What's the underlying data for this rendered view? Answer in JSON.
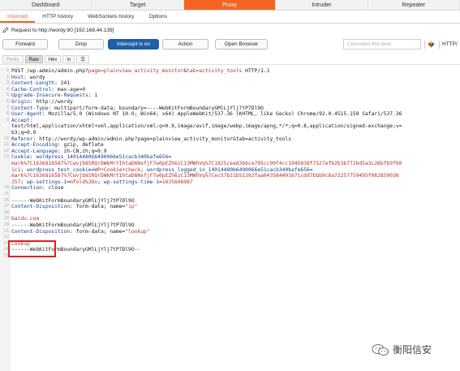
{
  "top_tabs": [
    {
      "label": "Dashboard",
      "active": false
    },
    {
      "label": "Target",
      "active": false
    },
    {
      "label": "Proxy",
      "active": true
    },
    {
      "label": "Intruder",
      "active": false
    },
    {
      "label": "Repeater",
      "active": false
    }
  ],
  "sub_tabs": [
    {
      "label": "Intercept",
      "active": true
    },
    {
      "label": "HTTP history",
      "active": false
    },
    {
      "label": "WebSockets history",
      "active": false
    },
    {
      "label": "Options",
      "active": false
    }
  ],
  "request_info": "Request to http://wordy:80  [192.168.44.139]",
  "toolbar": {
    "forward": "Forward",
    "drop": "Drop",
    "intercept": "Intercept is on",
    "action": "Action",
    "open_browser": "Open Browser",
    "comment_placeholder": "Comment this item",
    "http_label": "HTTP/"
  },
  "view_tabs": [
    "Pretty",
    "Raw",
    "Hex",
    "\\n",
    "☰"
  ],
  "editor_lines": [
    {
      "n": "1",
      "segs": [
        [
          "POST /wp-admin/admin.php?",
          ""
        ],
        [
          "page=plainview_activity_monitor",
          "r"
        ],
        [
          "&",
          ""
        ],
        [
          "tab=activity_tools",
          "r"
        ],
        [
          " HTTP/1.1",
          ""
        ]
      ]
    },
    {
      "n": "2",
      "segs": [
        [
          "Host",
          "k"
        ],
        [
          ": wordy",
          ""
        ]
      ]
    },
    {
      "n": "3",
      "segs": [
        [
          "Content-Length",
          "k"
        ],
        [
          ": 241",
          ""
        ]
      ]
    },
    {
      "n": "4",
      "segs": [
        [
          "Cache-Control",
          "k"
        ],
        [
          ": max-age=0",
          ""
        ]
      ]
    },
    {
      "n": "5",
      "segs": [
        [
          "Upgrade-Insecure-Requests",
          "k"
        ],
        [
          ": 1",
          ""
        ]
      ]
    },
    {
      "n": "6",
      "segs": [
        [
          "Origin",
          "k"
        ],
        [
          ": http://wordy",
          ""
        ]
      ]
    },
    {
      "n": "7",
      "segs": [
        [
          "Content-Type",
          "k"
        ],
        [
          ": multipart/form-data; boundary=----WebKitFormBoundaryGMlLjYlj7tP7Dl9O",
          ""
        ]
      ]
    },
    {
      "n": "8",
      "segs": [
        [
          "User-Agent",
          "k"
        ],
        [
          ": Mozilla/5.0 (Windows NT 10.0; Win64; x64) AppleWebKit/537.36 (KHTML, like Gecko) Chrome/92.0.4515.159 Safari/537.36",
          ""
        ]
      ]
    },
    {
      "n": "9",
      "segs": [
        [
          "Accept",
          "k"
        ],
        [
          ":",
          ""
        ]
      ]
    },
    {
      "n": "",
      "segs": [
        [
          "text/html,application/xhtml+xml,application/xml;q=0.9,image/avif,image/webp,image/apng,*/*;q=0.8,application/signed-exchange;v=",
          ""
        ]
      ]
    },
    {
      "n": "",
      "segs": [
        [
          "b3;q=0.9",
          ""
        ]
      ]
    },
    {
      "n": "10",
      "segs": [
        [
          "Referer",
          "k"
        ],
        [
          ": http://wordy/wp-admin/admin.php?page=plainview_activity_monitor&tab=activity_tools",
          ""
        ]
      ]
    },
    {
      "n": "11",
      "segs": [
        [
          "Accept-Encoding",
          "k"
        ],
        [
          ": gzip, deflate",
          ""
        ]
      ]
    },
    {
      "n": "12",
      "segs": [
        [
          "Accept-Language",
          "k"
        ],
        [
          ": zh-CN,zh;q=0.9",
          ""
        ]
      ]
    },
    {
      "n": "13",
      "segs": [
        [
          "Cookie",
          "k"
        ],
        [
          ": ",
          ""
        ],
        [
          "wordpress_14014480b6490066e51cacb340bafe656",
          "b"
        ],
        [
          "=",
          ""
        ]
      ]
    },
    {
      "n": "",
      "segs": [
        [
          "mark%7C1636816587%7Cwvjb85RQrDWkMrYIhtaD6NxfjF7w0pEZh6zC13MWhVq%7C1825cead366ce795cc90f4cc1945038f7527efb2b3b772bd5a3c26bfb9f60",
          "r"
        ]
      ]
    },
    {
      "n": "",
      "segs": [
        [
          "1c1",
          "r"
        ],
        [
          "; ",
          ""
        ],
        [
          "wordpress_test_cookie",
          "b"
        ],
        [
          "=",
          ""
        ],
        [
          "WP+Cookie+check",
          "r"
        ],
        [
          "; ",
          ""
        ],
        [
          "wordpress_logged_in_14014480b6490066e51cacb340bafe656",
          "b"
        ],
        [
          "=",
          ""
        ]
      ]
    },
    {
      "n": "",
      "segs": [
        [
          "mark%7C1636816587%7Cwvjb85RQrDWkMrYIhtaD6NxfjF7w0pEZh6zC13MWhVq%7Cec57b31b51392faa043584491671cdd7bbb9c8a72257759495f062859036",
          "r"
        ]
      ]
    },
    {
      "n": "",
      "segs": [
        [
          "357",
          "r"
        ],
        [
          "; ",
          ""
        ],
        [
          "wp-settings-1",
          "b"
        ],
        [
          "=",
          ""
        ],
        [
          "mfold%3Do",
          "r"
        ],
        [
          "; ",
          ""
        ],
        [
          "wp-settings-time-1",
          "b"
        ],
        [
          "=",
          ""
        ],
        [
          "1635606987",
          "r"
        ]
      ]
    },
    {
      "n": "14",
      "segs": [
        [
          "Connection",
          "k"
        ],
        [
          ": close",
          ""
        ]
      ]
    },
    {
      "n": "15",
      "segs": []
    },
    {
      "n": "16",
      "segs": [
        [
          "------WebKitFormBoundaryGMlLjYlj7tP7Dl9O",
          ""
        ]
      ]
    },
    {
      "n": "17",
      "segs": [
        [
          "Content-Disposition",
          "k"
        ],
        [
          ": form-data; name=",
          ""
        ],
        [
          "\"ip\"",
          "r"
        ]
      ]
    },
    {
      "n": "18",
      "segs": []
    },
    {
      "n": "19",
      "segs": [
        [
          "baidu.com",
          "r"
        ]
      ]
    },
    {
      "n": "20",
      "segs": [
        [
          "------WebKitFormBoundaryGMlLjYlj7tP7Dl9O",
          ""
        ]
      ]
    },
    {
      "n": "21",
      "segs": [
        [
          "Content-Disposition",
          "k"
        ],
        [
          ": form-data; name=",
          ""
        ],
        [
          "\"lookup\"",
          "r"
        ]
      ]
    },
    {
      "n": "22",
      "segs": []
    },
    {
      "n": "23",
      "segs": [
        [
          "Lookup",
          "r"
        ]
      ]
    },
    {
      "n": "24",
      "segs": [
        [
          "------WebKitFormBoundaryGMlLjYlj7tP7Dl9O--",
          ""
        ]
      ]
    },
    {
      "n": "25",
      "segs": []
    }
  ],
  "watermark": "衡阳信安",
  "colors": {
    "accent": "#f26522",
    "primary_button": "#1e5fa8",
    "highlight_box": "#e02020",
    "header_key": "#1a3f8a",
    "value_red": "#b3322a"
  }
}
